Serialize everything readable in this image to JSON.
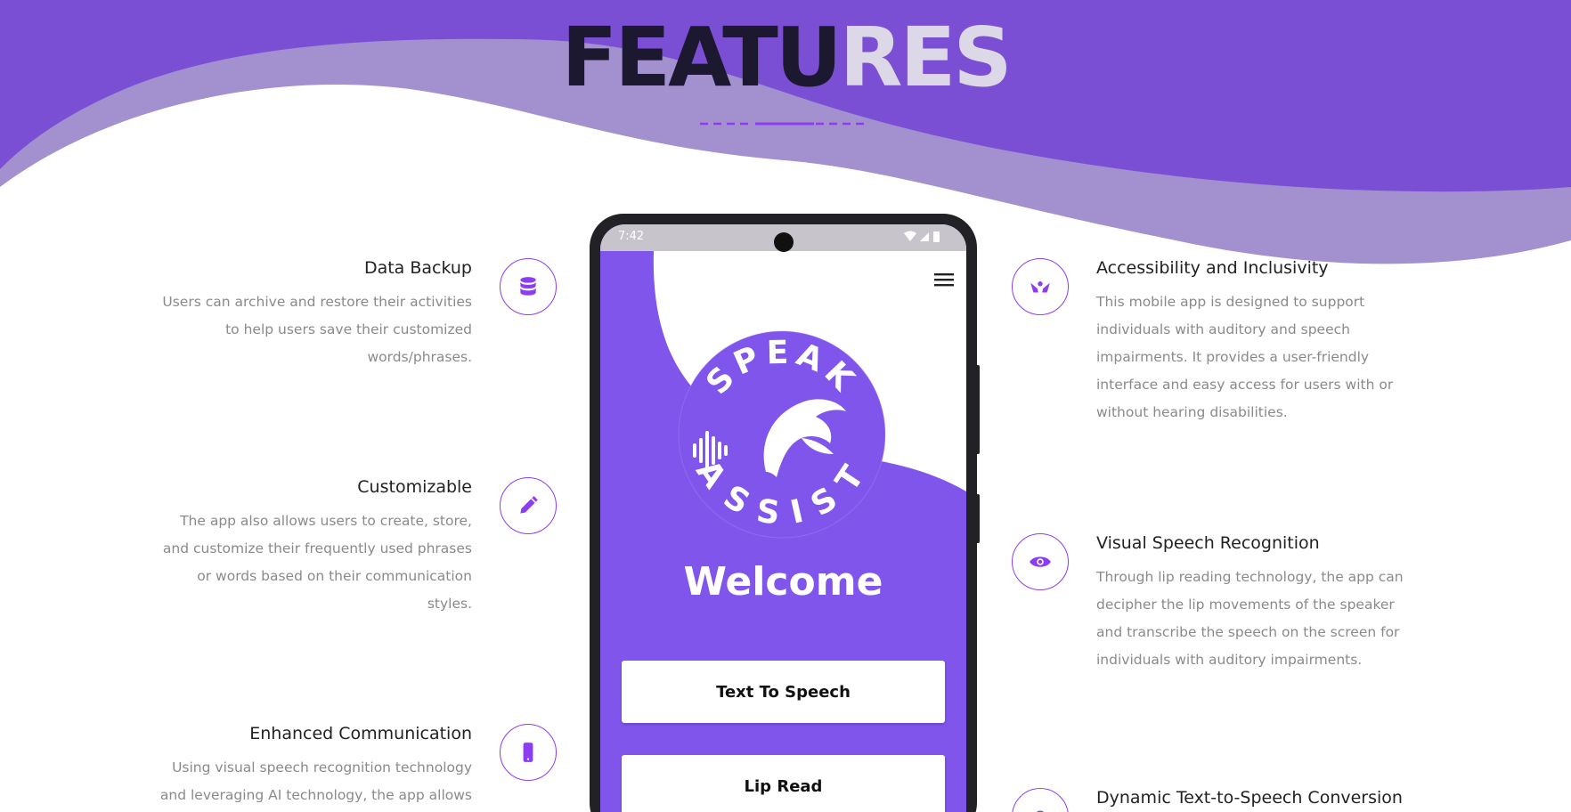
{
  "heading": {
    "dark": "FEATU",
    "light": "RES"
  },
  "features_left": [
    {
      "title": "Data Backup",
      "lines": [
        "Users can archive and restore their activities",
        "to help users save their customized",
        "words/phrases."
      ],
      "icon": "database-icon"
    },
    {
      "title": "Customizable",
      "lines": [
        "The app also allows users to create, store,",
        "and customize their frequently used phrases",
        "or words based on their communication",
        "styles."
      ],
      "icon": "pencil-icon"
    },
    {
      "title": "Enhanced Communication",
      "lines": [
        "Using visual speech recognition technology",
        "and leveraging AI technology, the app allows"
      ],
      "icon": "mobile-icon"
    }
  ],
  "features_right": [
    {
      "title": "Accessibility and Inclusivity",
      "lines": [
        "This mobile app is designed to support",
        "individuals with auditory and speech",
        "impairments. It provides a user-friendly",
        "interface and easy access for users with or",
        "without hearing disabilities."
      ],
      "icon": "hands-icon"
    },
    {
      "title": "Visual Speech Recognition",
      "lines": [
        "Through lip reading technology, the app can",
        "decipher the lip movements of the speaker",
        "and transcribe the speech on the screen for",
        "individuals with auditory impairments."
      ],
      "icon": "eye-icon"
    },
    {
      "title": "Dynamic Text-to-Speech Conversion",
      "lines": [],
      "icon": "speech-icon"
    }
  ],
  "phone": {
    "time": "7:42",
    "logo_top": "SPEAK",
    "logo_bottom": "ASSIST",
    "welcome": "Welcome",
    "buttons": [
      "Text To Speech",
      "Lip Read"
    ]
  },
  "colors": {
    "purple": "#7b4fd3",
    "accent": "#8d3df0",
    "screen": "#7f55ec"
  }
}
